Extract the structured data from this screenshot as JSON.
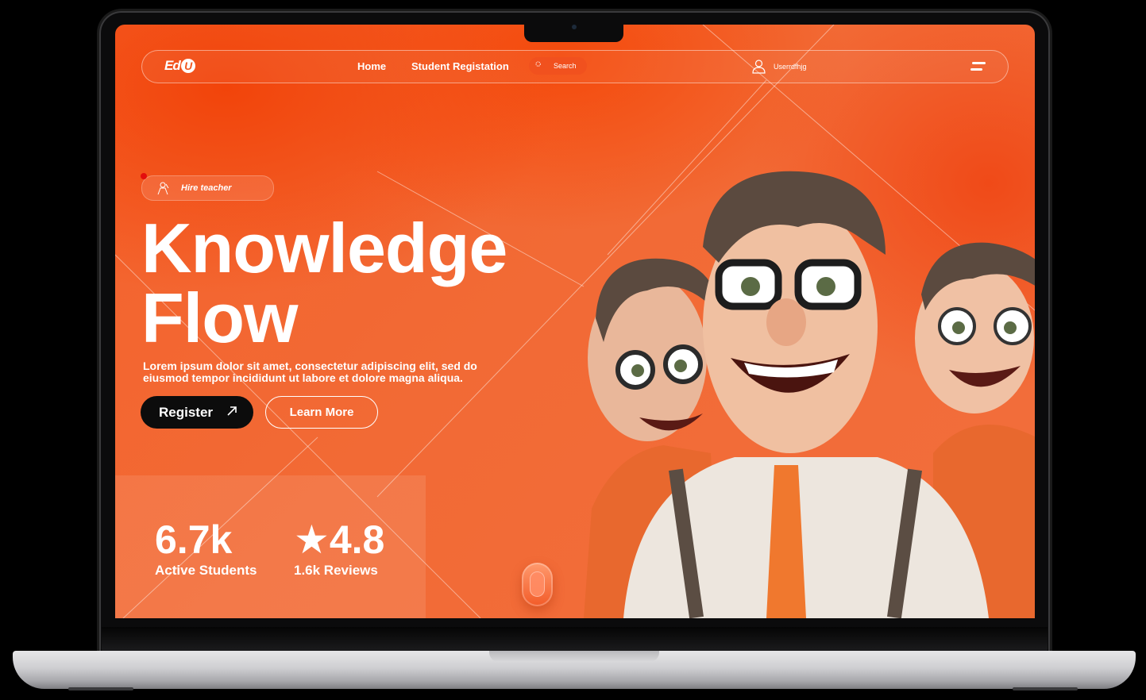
{
  "brand": {
    "logo_prefix": "Ed",
    "logo_u": "U"
  },
  "nav": {
    "links": [
      "Home",
      "Student Registation"
    ],
    "search_placeholder": "Search",
    "username": "Userrdfhjg"
  },
  "hero": {
    "chip_label": "Hire teacher",
    "title_line1": "Knowledge",
    "title_line2": "Flow",
    "description": "Lorem ipsum dolor sit amet, consectetur adipiscing elit, sed do eiusmod tempor incididunt ut labore et dolore magna aliqua.",
    "register_label": "Register",
    "learn_more_label": "Learn More"
  },
  "stats": [
    {
      "value": "6.7k",
      "label": "Active Students"
    },
    {
      "value": "★4.8",
      "label": "1.6k Reviews"
    }
  ],
  "colors": {
    "accent": "#f26a35",
    "accent_deep": "#f2440a",
    "button_dark": "#0c0c0c"
  }
}
